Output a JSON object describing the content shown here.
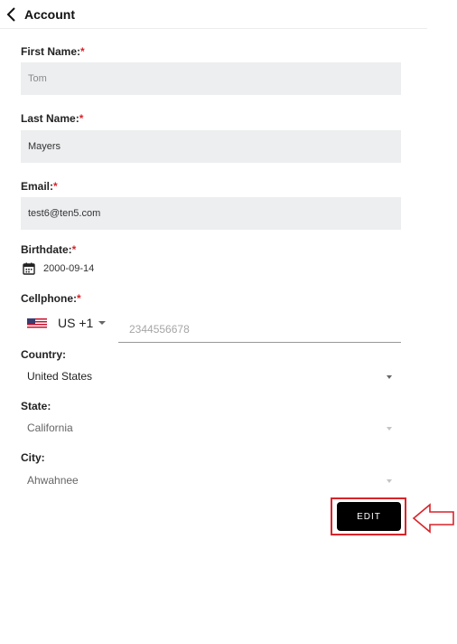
{
  "header": {
    "title": "Account"
  },
  "form": {
    "required_mark": "*",
    "first_name": {
      "label": "First Name:",
      "value": "Tom"
    },
    "last_name": {
      "label": "Last Name:",
      "value": "Mayers"
    },
    "email": {
      "label": "Email:",
      "value": "test6@ten5.com"
    },
    "birthdate": {
      "label": "Birthdate:",
      "value": "2000-09-14"
    },
    "cellphone": {
      "label": "Cellphone:",
      "country_code": "US +1",
      "placeholder": "2344556678"
    },
    "country": {
      "label": "Country:",
      "value": "United States"
    },
    "state": {
      "label": "State:",
      "value": "California"
    },
    "city": {
      "label": "City:",
      "value": "Ahwahnee"
    }
  },
  "actions": {
    "edit_label": "EDIT"
  },
  "colors": {
    "accent_red": "#d9242b",
    "button_bg": "#000000",
    "field_bg": "#eceeef"
  }
}
